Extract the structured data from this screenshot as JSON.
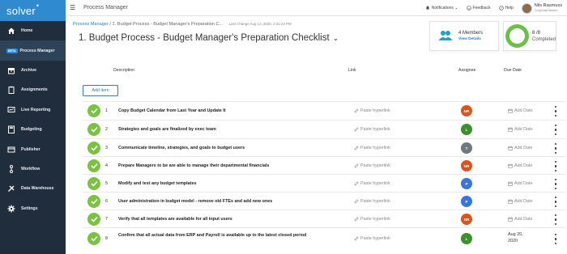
{
  "brand": {
    "name": "solver",
    "color": "#2f8ad0"
  },
  "sidebar": {
    "items": [
      {
        "label": "Home",
        "icon": "home-icon"
      },
      {
        "label": "Process Manager",
        "icon": "process-manager-icon",
        "badge": "BETA",
        "active": true
      },
      {
        "label": "Archive",
        "icon": "archive-icon"
      },
      {
        "label": "Assignments",
        "icon": "assignments-icon"
      },
      {
        "label": "Live Reporting",
        "icon": "live-reporting-icon"
      },
      {
        "label": "Budgeting",
        "icon": "budgeting-icon"
      },
      {
        "label": "Publisher",
        "icon": "publisher-icon"
      },
      {
        "label": "Workflow",
        "icon": "workflow-icon"
      },
      {
        "label": "Data Warehouse",
        "icon": "data-warehouse-icon"
      },
      {
        "label": "Settings",
        "icon": "settings-icon"
      }
    ]
  },
  "topbar": {
    "app_title": "Process Manager",
    "notifications": "Notifications",
    "feedback": "Feedback",
    "help": "Help",
    "user_name": "Nils Rasmuss",
    "user_role": "CorpData Master"
  },
  "breadcrumb": {
    "root": "Process Manager",
    "separator": "/",
    "current": "1. Budget Process - Budget Manager's Preparation C...",
    "last_change": "Last Change Aug 13, 2020, 2:31:24 PM"
  },
  "page": {
    "title": "1. Budget Process - Budget Manager's Preparation Checklist"
  },
  "members_card": {
    "count": "4 Members",
    "view": "View Details"
  },
  "progress_card": {
    "count": "8 /8",
    "label": "Completed",
    "fraction": 1.0
  },
  "table": {
    "headers": {
      "description": "Description",
      "link": "Link",
      "assignee": "Assignee",
      "due": "Due Date"
    },
    "add_item": "Add item",
    "rows": [
      {
        "num": "1",
        "desc": "Copy Budget Calendar from Last Year and Update It",
        "link": "Paste hyperlink",
        "assignee": "NR",
        "color": "#d9541e",
        "due": "Add Date"
      },
      {
        "num": "2",
        "desc": "Strategies and goals are finalized by exec team",
        "link": "Paste hyperlink",
        "assignee": "L",
        "color": "#3f8f2f",
        "due": "Add Date"
      },
      {
        "num": "3",
        "desc": "Communicate timeline, strategies, and goals to budget users",
        "link": "Paste hyperlink",
        "assignee": "T",
        "color": "#6f7a80",
        "due": "Add Date"
      },
      {
        "num": "4",
        "desc": "Prepare Managers to be are able to manage their departmental financials",
        "link": "Paste hyperlink",
        "assignee": "NR",
        "color": "#d9541e",
        "due": "Add Date"
      },
      {
        "num": "5",
        "desc": "Modify and test any budget templates",
        "link": "Paste hyperlink",
        "assignee": "P",
        "color": "#3a76d8",
        "due": "Add Date"
      },
      {
        "num": "6",
        "desc": "User administration in budget model - remove old FTEs and add new ones",
        "link": "Paste hyperlink",
        "assignee": "P",
        "color": "#3a76d8",
        "due": "Add Date"
      },
      {
        "num": "7",
        "desc": "Verify that all templates are available for all input users",
        "link": "Paste hyperlink",
        "assignee": "NR",
        "color": "#d9541e",
        "due": "Add Date"
      },
      {
        "num": "8",
        "desc": "Confirm that all actual data from ERP and Payroll is available up to the latest closed period",
        "link": "Paste hyperlink",
        "assignee": "L",
        "color": "#3f8f2f",
        "due": "Aug 20, 2020"
      }
    ]
  }
}
